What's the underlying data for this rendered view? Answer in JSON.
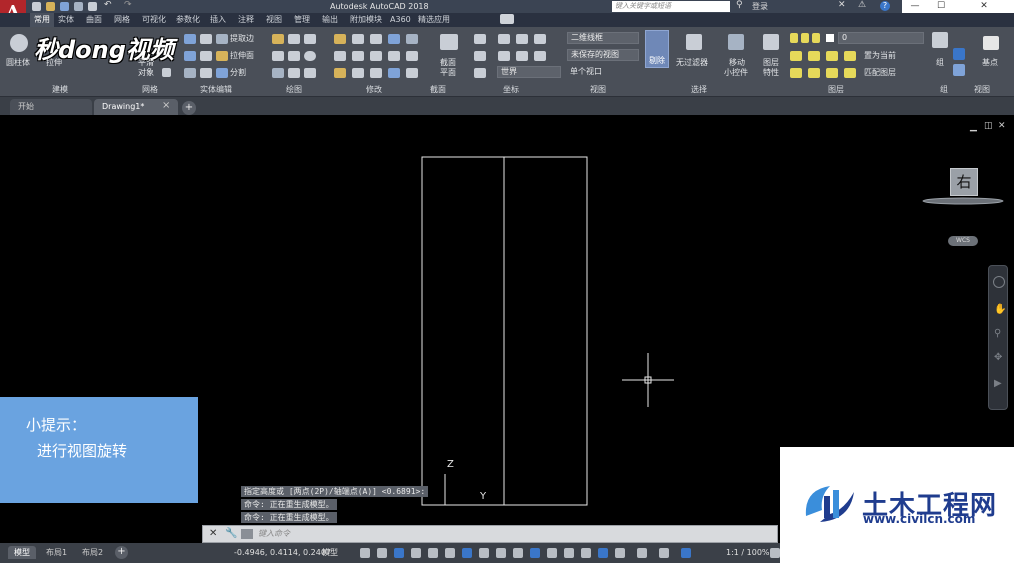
{
  "app": {
    "logo_letter": "A",
    "title": "Autodesk AutoCAD 2018",
    "search_placeholder": "键入关键字或短语",
    "login_label": "登录",
    "win_min": "—",
    "win_max": "☐",
    "win_close": "✕"
  },
  "ribbon_tabs": [
    "常用",
    "实体",
    "曲面",
    "网格",
    "可视化",
    "参数化",
    "插入",
    "注释",
    "视图",
    "管理",
    "输出",
    "附加模块",
    "A360",
    "精选应用"
  ],
  "ribbon": {
    "cylinder_label": "圆柱体",
    "extrude_label": "拉伸",
    "smooth_label_1": "平滑",
    "smooth_label_2": "对象",
    "extract_edges": "提取边",
    "extrude_face": "拉伸面",
    "separate": "分割",
    "section_label_1": "截面",
    "section_label_2": "平面",
    "visual_style": "二维线框",
    "saved_view": "未保存的视图",
    "single_viewport": "单个视口",
    "world": "世界",
    "cull_label": "剔除",
    "no_filter_label": "无过滤器",
    "move_gizmo_1": "移动",
    "move_gizmo_2": "小控件",
    "layer_props_1": "图层",
    "layer_props_2": "特性",
    "layer_name": "0",
    "set_current": "置为当前",
    "match_layer": "匹配图层",
    "group_label": "组",
    "base_point_label": "基点",
    "groups": {
      "modeling": "建模",
      "mesh": "网格",
      "solid_edit": "实体编辑",
      "draw": "绘图",
      "modify": "修改",
      "section": "截面",
      "coordinates": "坐标",
      "view": "视图",
      "selection": "选择",
      "layers": "图层",
      "group": "组",
      "view2": "视图"
    }
  },
  "file_tabs": {
    "start": "开始",
    "drawing": "Drawing1*",
    "close": "×",
    "add": "+"
  },
  "viewport": {
    "viewcube_face": "右",
    "wcs_label": "WCS",
    "axis_z": "Z",
    "axis_y": "Y"
  },
  "tip": {
    "title": "小提示：",
    "body": "进行视图旋转"
  },
  "command_history": [
    "指定高度或 [两点(2P)/轴端点(A)] <0.6891>:",
    "命令:   正在重生成模型。",
    "命令:   正在重生成模型。"
  ],
  "command_input_placeholder": "键入命令",
  "status": {
    "tabs": [
      "模型",
      "布局1",
      "布局2"
    ],
    "add_tab": "+",
    "coordinates": "-0.4946, 0.4114, 0.2407",
    "model_label": "模型",
    "scale": "1:1 / 100%"
  },
  "watermark": {
    "brand_top": "秒dong视频",
    "site_name": "土木工程网",
    "site_url": "www.civilcn.com"
  },
  "colors": {
    "tip_bg": "#6aa3e0",
    "app_red": "#b2262b",
    "watermark_blue": "#1f3c8e"
  }
}
